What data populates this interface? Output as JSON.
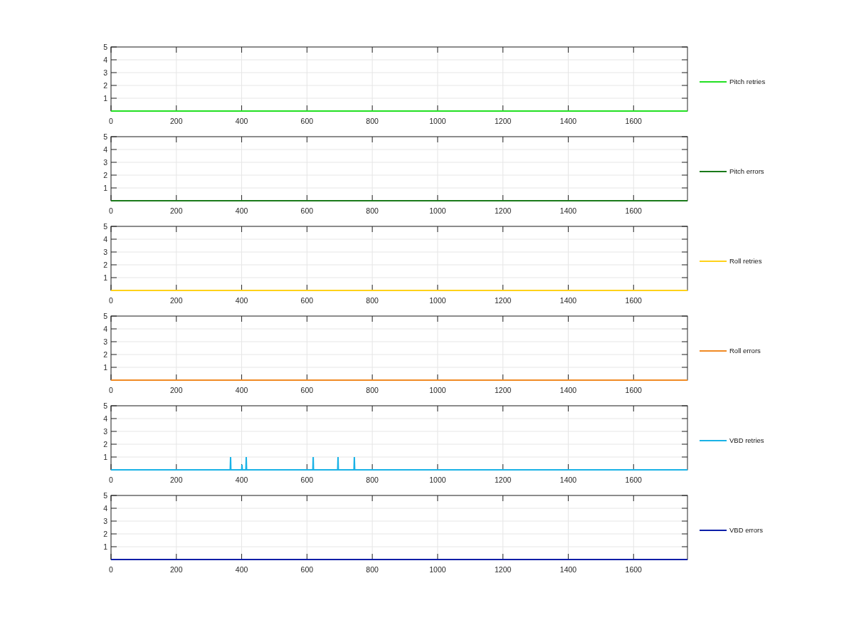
{
  "subplots": [
    {
      "chart_data": {
        "type": "line",
        "xlim": [
          0,
          1765
        ],
        "ylim": [
          0,
          5
        ],
        "xticks": [
          0,
          200,
          400,
          600,
          800,
          1000,
          1200,
          1400,
          1600
        ],
        "yticks": [
          1,
          2,
          3,
          4,
          5
        ],
        "grid": true,
        "x": [
          0,
          1765
        ],
        "series": [
          {
            "name": "Pitch retries",
            "color": "#22e022",
            "values": [
              0,
              0
            ]
          }
        ]
      }
    },
    {
      "chart_data": {
        "type": "line",
        "xlim": [
          0,
          1765
        ],
        "ylim": [
          0,
          5
        ],
        "xticks": [
          0,
          200,
          400,
          600,
          800,
          1000,
          1200,
          1400,
          1600
        ],
        "yticks": [
          1,
          2,
          3,
          4,
          5
        ],
        "grid": true,
        "x": [
          0,
          1765
        ],
        "series": [
          {
            "name": "Pitch errors",
            "color": "#1a7a1a",
            "values": [
              0,
              0
            ]
          }
        ]
      }
    },
    {
      "chart_data": {
        "type": "line",
        "xlim": [
          0,
          1765
        ],
        "ylim": [
          0,
          5
        ],
        "xticks": [
          0,
          200,
          400,
          600,
          800,
          1000,
          1200,
          1400,
          1600
        ],
        "yticks": [
          1,
          2,
          3,
          4,
          5
        ],
        "grid": true,
        "x": [
          0,
          1765
        ],
        "series": [
          {
            "name": "Roll retries",
            "color": "#ffd21a",
            "values": [
              0,
              0
            ]
          }
        ]
      }
    },
    {
      "chart_data": {
        "type": "line",
        "xlim": [
          0,
          1765
        ],
        "ylim": [
          0,
          5
        ],
        "xticks": [
          0,
          200,
          400,
          600,
          800,
          1000,
          1200,
          1400,
          1600
        ],
        "yticks": [
          1,
          2,
          3,
          4,
          5
        ],
        "grid": true,
        "x": [
          0,
          1765
        ],
        "series": [
          {
            "name": "Roll errors",
            "color": "#f08a24",
            "values": [
              0,
              0
            ]
          }
        ]
      }
    },
    {
      "chart_data": {
        "type": "line",
        "xlim": [
          0,
          1765
        ],
        "ylim": [
          0,
          5
        ],
        "xticks": [
          0,
          200,
          400,
          600,
          800,
          1000,
          1200,
          1400,
          1600
        ],
        "yticks": [
          1,
          2,
          3,
          4,
          5
        ],
        "grid": true,
        "x": [
          0,
          365,
          366,
          367,
          400,
          401,
          402,
          413,
          414,
          415,
          618,
          619,
          620,
          694,
          695,
          696,
          744,
          745,
          746,
          1765
        ],
        "series": [
          {
            "name": "VBD retries",
            "color": "#1ab2e6",
            "values": [
              0,
              0,
              1,
              0,
              0,
              0.4,
              0,
              0,
              1,
              0,
              0,
              1,
              0,
              0,
              1,
              0,
              0,
              1,
              0,
              0
            ]
          }
        ]
      }
    },
    {
      "chart_data": {
        "type": "line",
        "xlim": [
          0,
          1765
        ],
        "ylim": [
          0,
          5
        ],
        "xticks": [
          0,
          200,
          400,
          600,
          800,
          1000,
          1200,
          1400,
          1600
        ],
        "yticks": [
          1,
          2,
          3,
          4,
          5
        ],
        "grid": true,
        "x": [
          0,
          1765
        ],
        "series": [
          {
            "name": "VBD errors",
            "color": "#0c1ea8",
            "values": [
              0,
              0
            ]
          }
        ]
      }
    }
  ]
}
